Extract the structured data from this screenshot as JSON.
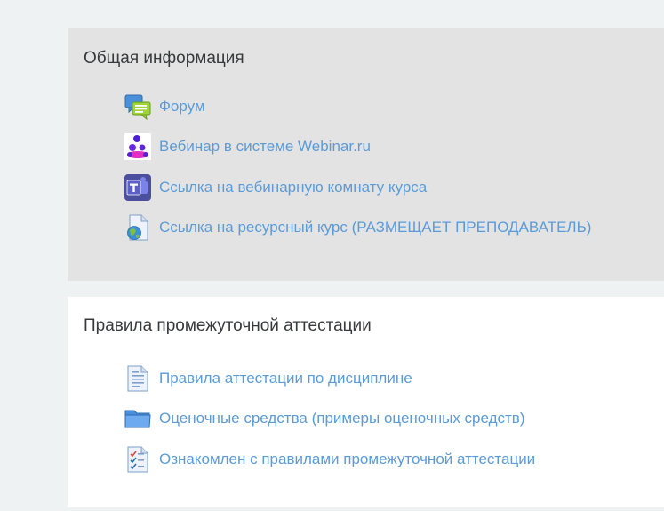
{
  "sections": [
    {
      "title": "Общая информация",
      "items": [
        {
          "label": "Форум",
          "icon": "forum-icon"
        },
        {
          "label": "Вебинар в системе Webinar.ru",
          "icon": "webinar-icon"
        },
        {
          "label": "Ссылка на вебинарную комнату курса",
          "icon": "teams-icon"
        },
        {
          "label": "Ссылка на ресурсный курс (РАЗМЕЩАЕТ ПРЕПОДАВАТЕЛЬ)",
          "icon": "url-globe-icon"
        }
      ]
    },
    {
      "title": "Правила промежуточной аттестации",
      "items": [
        {
          "label": "Правила аттестации по дисциплине",
          "icon": "page-icon"
        },
        {
          "label": "Оценочные средства (примеры оценочных средств)",
          "icon": "folder-icon"
        },
        {
          "label": "Ознакомлен с правилами промежуточной аттестации",
          "icon": "checklist-icon"
        }
      ]
    }
  ],
  "colors": {
    "page_background": "#eef2f2",
    "section_general_background": "#e3e3e3",
    "section_rules_background": "#ffffff",
    "link": "#5b9bd8",
    "title_text": "#373a3c"
  }
}
